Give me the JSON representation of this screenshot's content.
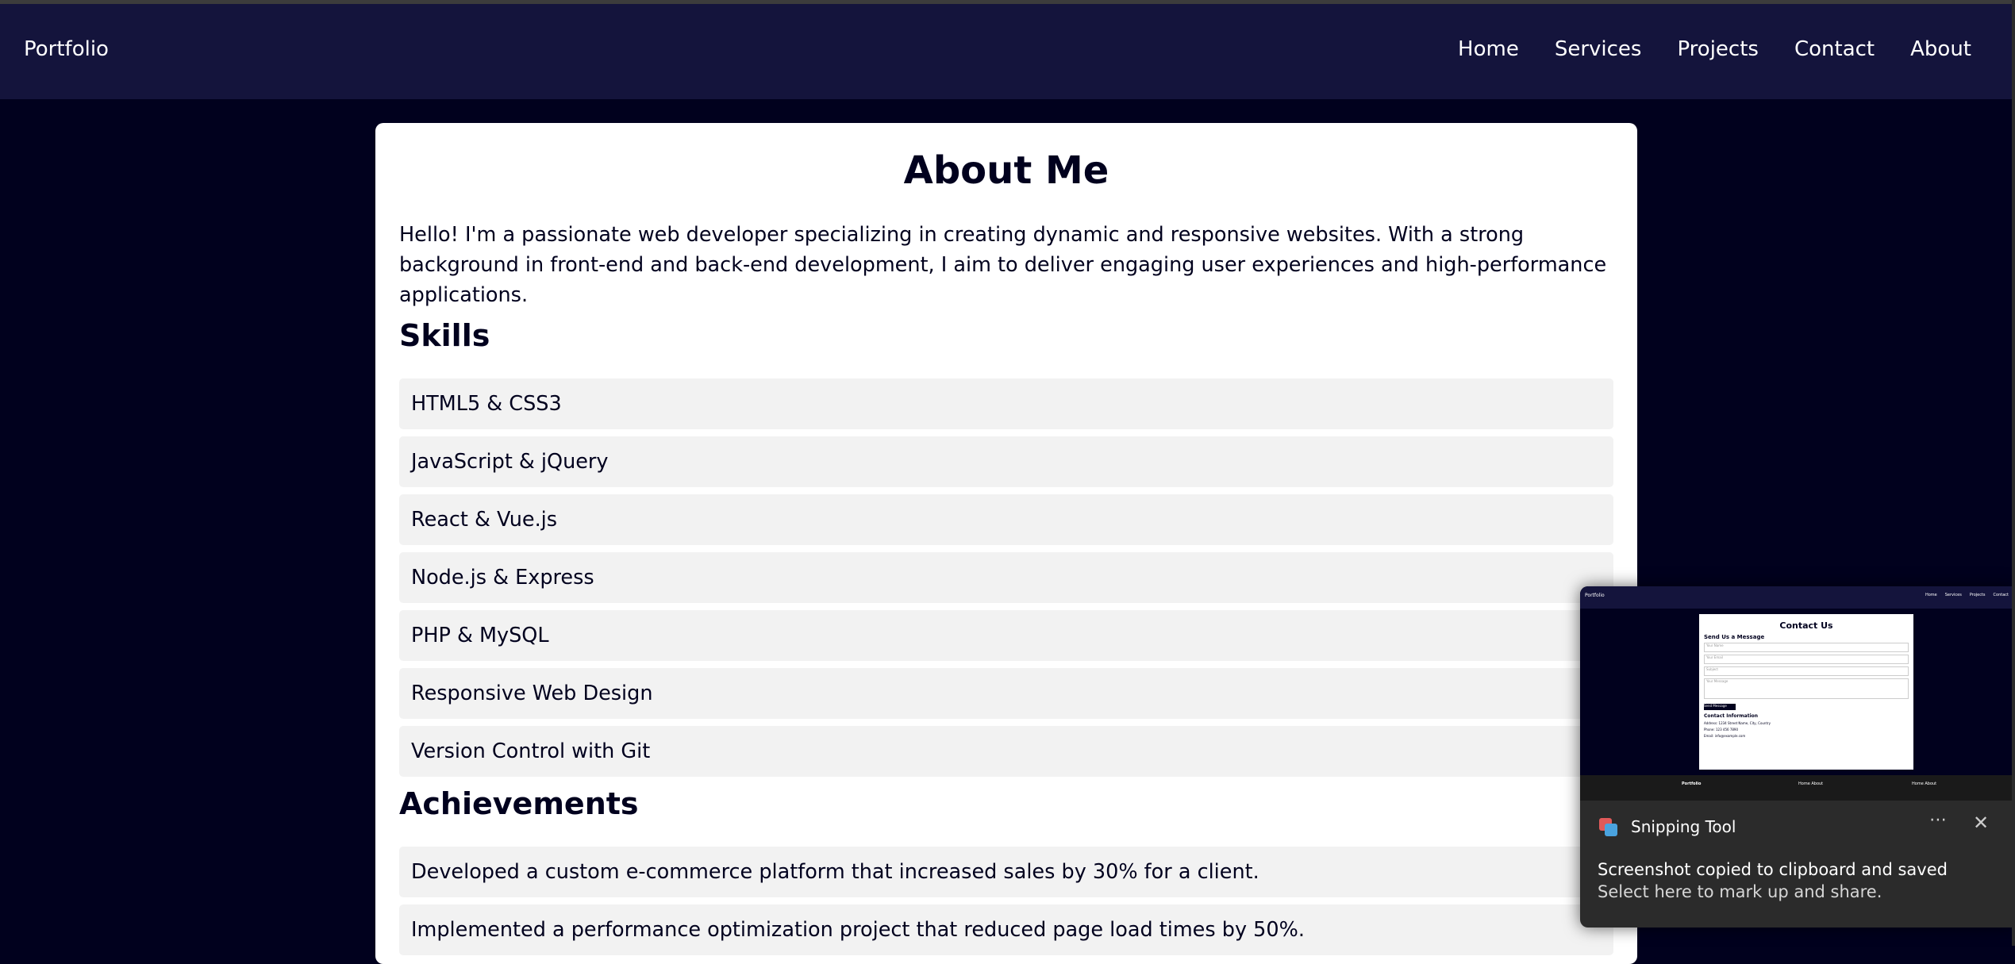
{
  "nav": {
    "brand": "Portfolio",
    "links": [
      "Home",
      "Services",
      "Projects",
      "Contact",
      "About"
    ]
  },
  "about": {
    "title": "About Me",
    "intro": "Hello! I'm a passionate web developer specializing in creating dynamic and responsive websites. With a strong background in front-end and back-end development, I aim to deliver engaging user experiences and high-performance applications.",
    "skills_heading": "Skills",
    "skills": [
      "HTML5 & CSS3",
      "JavaScript & jQuery",
      "React & Vue.js",
      "Node.js & Express",
      "PHP & MySQL",
      "Responsive Web Design",
      "Version Control with Git"
    ],
    "achievements_heading": "Achievements",
    "achievements": [
      "Developed a custom e-commerce platform that increased sales by 30% for a client.",
      "Implemented a performance optimization project that reduced page load times by 50%."
    ]
  },
  "toast": {
    "app_name": "Snipping Tool",
    "more_icon": "⋯",
    "close_icon": "✕",
    "title": "Screenshot copied to clipboard and saved",
    "message": "Select here to mark up and share.",
    "thumbnail": {
      "brand": "Portfolio",
      "links": [
        "Home",
        "Services",
        "Projects",
        "Contact"
      ],
      "heading": "Contact Us",
      "form_heading": "Send Us a Message",
      "fields": [
        "Your Name",
        "Your Email",
        "Subject"
      ],
      "textarea": "Your Message",
      "button": "Send Message",
      "info_heading": "Contact Information",
      "info_lines": [
        "Address: 1234 Street Name, City, Country",
        "Phone: 123 456 7890",
        "Email: info@example.com"
      ],
      "footer_cols": [
        "Portfolio",
        "Home About",
        "Home About"
      ]
    }
  },
  "colors": {
    "background": "#01011e",
    "navbar": "#14143c",
    "card": "#ffffff",
    "list_item": "#f2f2f2"
  }
}
